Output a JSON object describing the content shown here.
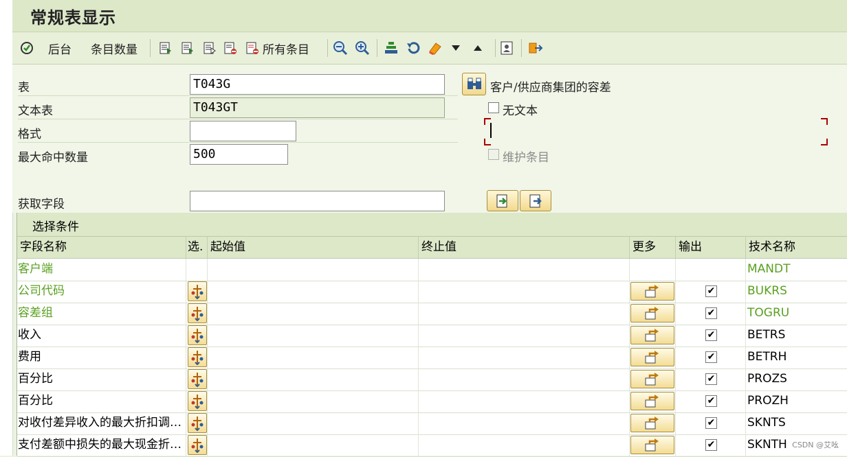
{
  "window": {
    "title": "常规表显示"
  },
  "toolbar": {
    "background_label": "后台",
    "entries_count_label": "条目数量",
    "all_entries_label": "所有条目"
  },
  "form": {
    "table_label": "表",
    "table_value": "T043G",
    "text_table_label": "文本表",
    "text_table_value": "T043GT",
    "format_label": "格式",
    "format_value": "",
    "max_hits_label": "最大命中数量",
    "max_hits_value": "500",
    "get_fields_label": "获取字段",
    "get_fields_value": "",
    "table_description": "客户/供应商集团的容差",
    "no_text_label": "无文本",
    "no_text_checked": false,
    "maintain_entries_label": "维护条目",
    "maintain_entries_checked": false
  },
  "selection": {
    "title": "选择条件",
    "columns": {
      "field_name": "字段名称",
      "sel": "选.",
      "from": "起始值",
      "to": "终止值",
      "more": "更多",
      "output": "输出",
      "tech_name": "技术名称"
    },
    "rows": [
      {
        "name": "客户端",
        "tech": "MANDT",
        "key": true,
        "has_buttons": false,
        "output": false
      },
      {
        "name": "公司代码",
        "tech": "BUKRS",
        "key": true,
        "has_buttons": true,
        "output": true
      },
      {
        "name": "容差组",
        "tech": "TOGRU",
        "key": true,
        "has_buttons": true,
        "output": true
      },
      {
        "name": "收入",
        "tech": "BETRS",
        "key": false,
        "has_buttons": true,
        "output": true
      },
      {
        "name": "费用",
        "tech": "BETRH",
        "key": false,
        "has_buttons": true,
        "output": true
      },
      {
        "name": "百分比",
        "tech": "PROZS",
        "key": false,
        "has_buttons": true,
        "output": true
      },
      {
        "name": "百分比",
        "tech": "PROZH",
        "key": false,
        "has_buttons": true,
        "output": true
      },
      {
        "name": "对收付差异收入的最大折扣调…",
        "tech": "SKNTS",
        "key": false,
        "has_buttons": true,
        "output": true
      },
      {
        "name": "支付差额中损失的最大现金折…",
        "tech": "SKNTH",
        "key": false,
        "has_buttons": true,
        "output": true
      }
    ]
  },
  "watermark": "CSDN @艾吆",
  "colors": {
    "key_field": "#5aa020",
    "header_bg": "#dde8c9",
    "button_gold": "#f2d98c"
  }
}
